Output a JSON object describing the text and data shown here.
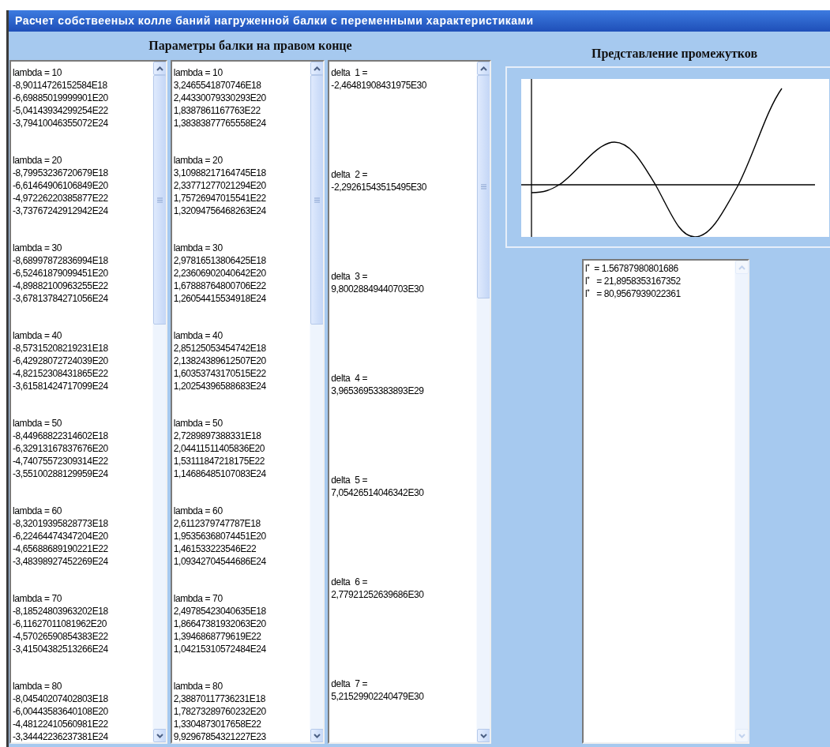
{
  "window": {
    "title": "Расчет собствееных колле баний нагруженной балки с переменными характеристиками"
  },
  "left_panel": {
    "heading": "Параметры балки на правом конце",
    "lists": [
      {
        "groups": [
          {
            "header": "lambda = 10",
            "values": [
              "-8,90114726152584E18",
              "-6,69885019999901E20",
              "-5,04143934299254E22",
              "-3,79410046355072E24"
            ]
          },
          {
            "header": "lambda = 20",
            "values": [
              "-8,79953236720679E18",
              "-6,61464906106849E20",
              "-4,97226220385877E22",
              "-3,73767242912942E24"
            ]
          },
          {
            "header": "lambda = 30",
            "values": [
              "-8,68997872836994E18",
              "-6,52461879099451E20",
              "-4,89882100963255E22",
              "-3,67813784271056E24"
            ]
          },
          {
            "header": "lambda = 40",
            "values": [
              "-8,57315208219231E18",
              "-6,42928072724039E20",
              "-4,82152308431865E22",
              "-3,61581424717099E24"
            ]
          },
          {
            "header": "lambda = 50",
            "values": [
              "-8,44968822314602E18",
              "-6,32913167837676E20",
              "-4,74075572309314E22",
              "-3,55100288129959E24"
            ]
          },
          {
            "header": "lambda = 60",
            "values": [
              "-8,32019395828773E18",
              "-6,22464474347204E20",
              "-4,65688689190221E22",
              "-3,48398927452269E24"
            ]
          },
          {
            "header": "lambda = 70",
            "values": [
              "-8,18524803963202E18",
              "-6,11627011081962E20",
              "-4,57026590854383E22",
              "-3,41504382513266E24"
            ]
          },
          {
            "header": "lambda = 80",
            "values": [
              "-8,04540207402803E18",
              "-6,00443583640108E20",
              "-4,48122410560981E22",
              "-3,34442236237381E24"
            ]
          }
        ]
      },
      {
        "groups": [
          {
            "header": "lambda = 10",
            "values": [
              "3,2465541870746E18",
              "2,44330079330293E20",
              "1,8387861167763E22",
              "1,38383877765558E24"
            ]
          },
          {
            "header": "lambda = 20",
            "values": [
              "3,10988217164745E18",
              "2,33771277021294E20",
              "1,75726947015541E22",
              "1,32094756468263E24"
            ]
          },
          {
            "header": "lambda = 30",
            "values": [
              "2,97816513806425E18",
              "2,23606902040642E20",
              "1,67888764800706E22",
              "1,26054415534918E24"
            ]
          },
          {
            "header": "lambda = 40",
            "values": [
              "2,85125053454742E18",
              "2,13824389612507E20",
              "1,60353743170515E22",
              "1,20254396588683E24"
            ]
          },
          {
            "header": "lambda = 50",
            "values": [
              "2,7289897388331E18",
              "2,04411511405836E20",
              "1,53111847218175E22",
              "1,14686485107083E24"
            ]
          },
          {
            "header": "lambda = 60",
            "values": [
              "2,6112379747787E18",
              "1,95356368074451E20",
              "1,461533223546E22",
              "1,09342704544686E24"
            ]
          },
          {
            "header": "lambda = 70",
            "values": [
              "2,49785423040635E18",
              "1,86647381932063E20",
              "1,3946868779619E22",
              "1,04215310572484E24"
            ]
          },
          {
            "header": "lambda = 80",
            "values": [
              "2,38870117736231E18",
              "1,78273289760232E20",
              "1,3304873017658E22",
              "9,92967854321227E23"
            ]
          }
        ]
      },
      {
        "groups": [
          {
            "header": "delta  1 =",
            "values": [
              "-2,46481908431975E30"
            ]
          },
          {
            "header": "delta  2 =",
            "values": [
              "-2,29261543515495E30"
            ]
          },
          {
            "header": "delta  3 =",
            "values": [
              "9,80028849440703E30"
            ]
          },
          {
            "header": "delta  4 =",
            "values": [
              "3,96536953383893E29"
            ]
          },
          {
            "header": "delta  5 =",
            "values": [
              "7,05426514046342E30"
            ]
          },
          {
            "header": "delta  6 =",
            "values": [
              "2,77921252639686E30"
            ]
          },
          {
            "header": "delta  7 =",
            "values": [
              "5,21529902240479E30"
            ]
          }
        ]
      }
    ]
  },
  "right_panel": {
    "heading": "Представление промежутков",
    "results": [
      "l$^{*}$  = 1.56787980801686",
      "l$^{*}$   = 21,8958353167352",
      "l$^{*}$   = 80,9567939022361"
    ]
  }
}
